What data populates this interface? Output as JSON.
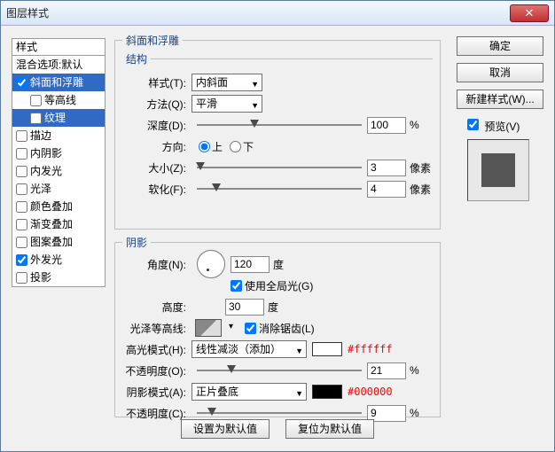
{
  "window": {
    "title": "图层样式"
  },
  "sidebar": {
    "header": "样式",
    "items": [
      {
        "label": "混合选项:默认",
        "check": null
      },
      {
        "label": "斜面和浮雕",
        "check": true,
        "selected": true
      },
      {
        "label": "等高线",
        "check": false,
        "sub": true
      },
      {
        "label": "纹理",
        "check": false,
        "sub": true,
        "selected": true
      },
      {
        "label": "描边",
        "check": false
      },
      {
        "label": "内阴影",
        "check": false
      },
      {
        "label": "内发光",
        "check": false
      },
      {
        "label": "光泽",
        "check": false
      },
      {
        "label": "颜色叠加",
        "check": false
      },
      {
        "label": "渐变叠加",
        "check": false
      },
      {
        "label": "图案叠加",
        "check": false
      },
      {
        "label": "外发光",
        "check": true
      },
      {
        "label": "投影",
        "check": false
      }
    ]
  },
  "bevel": {
    "legend": "斜面和浮雕",
    "structure_legend": "结构",
    "style_label": "样式(T):",
    "style_value": "内斜面",
    "technique_label": "方法(Q):",
    "technique_value": "平滑",
    "depth_label": "深度(D):",
    "depth_value": "100",
    "depth_unit": "%",
    "direction_label": "方向:",
    "dir_up": "上",
    "dir_down": "下",
    "size_label": "大小(Z):",
    "size_value": "3",
    "size_unit": "像素",
    "soften_label": "软化(F):",
    "soften_value": "4",
    "soften_unit": "像素"
  },
  "shadow": {
    "legend": "阴影",
    "angle_label": "角度(N):",
    "angle_value": "120",
    "angle_unit": "度",
    "global_light_label": "使用全局光(G)",
    "altitude_label": "高度:",
    "altitude_value": "30",
    "altitude_unit": "度",
    "gloss_label": "光泽等高线:",
    "antialias_label": "消除锯齿(L)",
    "hl_mode_label": "高光模式(H):",
    "hl_mode_value": "线性减淡（添加）",
    "hl_hex": "#ffffff",
    "hl_op_label": "不透明度(O):",
    "hl_op_value": "21",
    "hl_op_unit": "%",
    "sh_mode_label": "阴影模式(A):",
    "sh_mode_value": "正片叠底",
    "sh_hex": "#000000",
    "sh_op_label": "不透明度(C):",
    "sh_op_value": "9",
    "sh_op_unit": "%"
  },
  "footer": {
    "make_default": "设置为默认值",
    "reset_default": "复位为默认值"
  },
  "right": {
    "ok": "确定",
    "cancel": "取消",
    "new_style": "新建样式(W)...",
    "preview_label": "预览(V)"
  }
}
